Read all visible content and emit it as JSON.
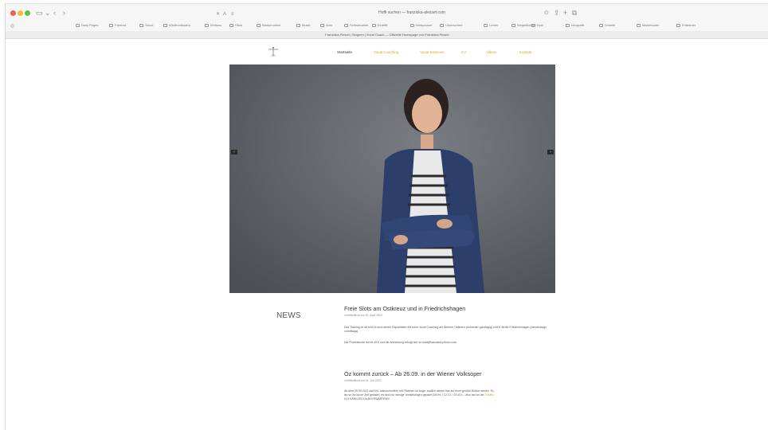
{
  "browser": {
    "url": "Hoffi suchen — franziska-alesset.com",
    "tab_title": "Franziska Plesch | Singerin | Vocal Coach — Offizielle Homepage von Franziska Plesch",
    "favorites": [
      "Daily Pages",
      "Fahrrad",
      "Shout",
      "Weltfrontklubra",
      "Einfluss",
      "Hitze",
      "Bankeronline",
      "Musik",
      "Auto",
      "Selbstmarkte",
      "Eintrifft",
      "Webpauser",
      "Unterschied",
      "Lehrer",
      "Wegleitfahrer",
      "Epol",
      "Infografik",
      "Vorteile",
      "Markerkarte",
      "Entleeder"
    ]
  },
  "site": {
    "nav": [
      {
        "label": "Startseite",
        "active": true
      },
      {
        "label": "Vocal Coaching",
        "active": false
      },
      {
        "label": "Vocal Sessions",
        "active": false
      },
      {
        "label": "CV",
        "active": false
      },
      {
        "label": "Videos",
        "active": false
      },
      {
        "label": "Kontakt",
        "active": false
      }
    ],
    "news_heading": "NEWS",
    "posts": [
      {
        "title": "Freie Slots am Ostkreuz und in Friedrichshagen",
        "meta": "veröffentlicht am 20. April 2022",
        "paragraphs": [
          "Das Training ist da und es sind wieder Kapazitäten frei beim Vocal Coaching am Berliner Ostkreuz (entweder ganztägig) und in Berlin Friedrichshagen (donnerstags vormittags).",
          "Die Probestunde ist mit 40 € und die Anmeldung erfolgt hier an mail@franziska-plesch.com"
        ]
      },
      {
        "title": "Oz kommt zurück – Ab 26.09. in der Wiener Volksoper",
        "meta": "veröffentlicht am 14. Juli 2021",
        "paragraph_lines": [
          "Ab dem 26.09.2021 darf ich, wahrscheinlich mit Pfütchen im Auge, endlich wieder live auf einer großen Bühne stehen. Es",
          "ist nur für kurze Zeit gedacht, es sind nur wenige Vorstellungen geplant (26.09. / 12.10. / 20.10.) – also ran an die "
        ],
        "link_text": "Tickets!",
        "closing": "ICH KANN ES KAUM ERWARTEN!!!"
      }
    ]
  },
  "colors": {
    "accent": "#e3a21a",
    "hero_bg": "#5e6067"
  }
}
